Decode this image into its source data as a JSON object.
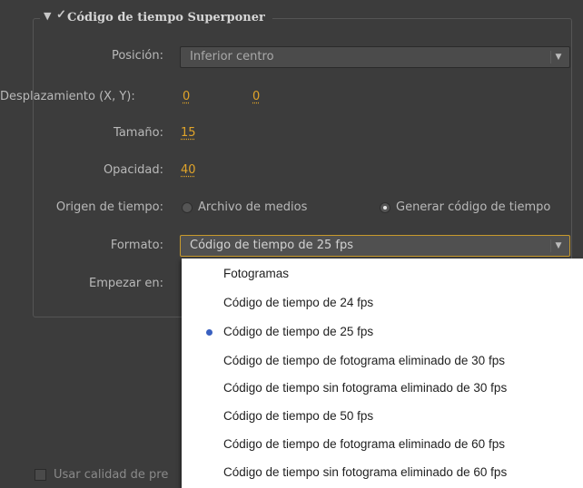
{
  "section": {
    "title": "Código de tiempo Superponer",
    "checked": true,
    "expanded": true
  },
  "fields": {
    "position": {
      "label": "Posición:",
      "value": "Inferior centro"
    },
    "offset": {
      "label": "Desplazamiento (X, Y):",
      "x": "0",
      "y": "0"
    },
    "size": {
      "label": "Tamaño:",
      "value": "15"
    },
    "opacity": {
      "label": "Opacidad:",
      "value": "40"
    },
    "time_origin": {
      "label": "Origen de tiempo:",
      "options": [
        {
          "label": "Archivo de medios",
          "selected": false
        },
        {
          "label": "Generar código de tiempo",
          "selected": true
        }
      ]
    },
    "format": {
      "label": "Formato:",
      "value": "Código de tiempo de 25 fps"
    },
    "start_at": {
      "label": "Empezar en:"
    }
  },
  "format_menu": {
    "items": [
      "Fotogramas",
      "Código de tiempo de 24 fps",
      "Código de tiempo de 25 fps",
      "Código de tiempo de fotograma eliminado de 30 fps",
      "Código de tiempo sin fotograma eliminado de 30 fps",
      "Código de tiempo de 50 fps",
      "Código de tiempo de fotograma eliminado de 60 fps",
      "Código de tiempo sin fotograma eliminado de 60 fps"
    ],
    "selected_index": 2
  },
  "footer": {
    "checkbox_label": "Usar calidad de pre",
    "checked": false
  },
  "colors": {
    "panel_bg": "#3c3c3c",
    "value_accent": "#e0a42a",
    "active_border": "#c89a2c",
    "menu_bg": "#ffffff",
    "selection_dot": "#3960c0"
  }
}
